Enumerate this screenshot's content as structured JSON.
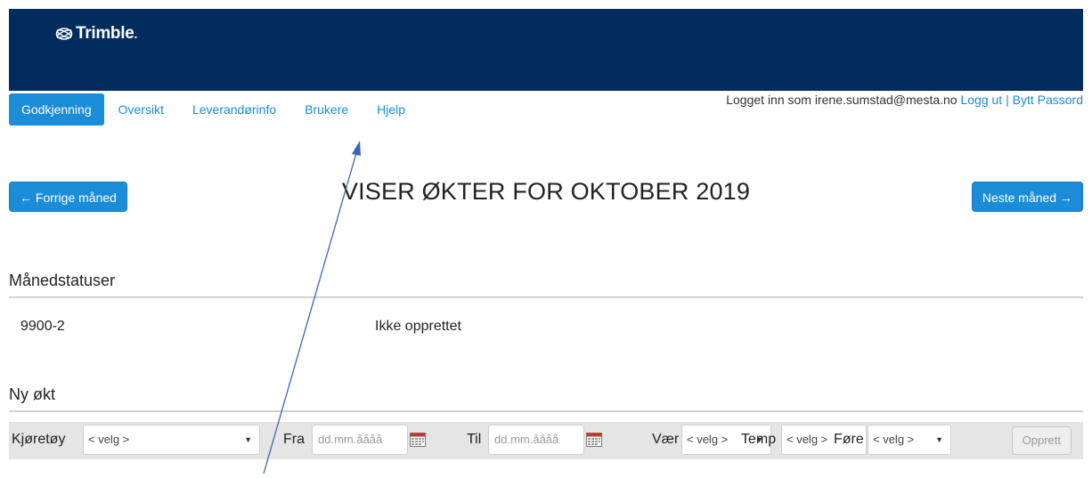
{
  "header": {
    "logo_text": "Trimble",
    "logo_dot": ".",
    "bg_color": "#012c5b"
  },
  "nav": {
    "items": [
      {
        "label": "Godkjenning",
        "active": true
      },
      {
        "label": "Oversikt"
      },
      {
        "label": "Leverandørinfo"
      },
      {
        "label": "Brukere"
      },
      {
        "label": "Hjelp"
      }
    ]
  },
  "userbar": {
    "logged_in_text": "Logget inn som irene.sumstad@mesta.no",
    "logout_label": "Logg ut",
    "separator": "|",
    "change_password_label": "Bytt Passord"
  },
  "month_nav": {
    "prev_label": "← Forrige måned",
    "next_label": "Neste måned →",
    "title": "VISER ØKTER FOR OKTOBER 2019"
  },
  "month_status": {
    "title": "Månedstatuser",
    "rows": [
      {
        "code": "9900-2",
        "status": "Ikke opprettet"
      }
    ]
  },
  "new_session": {
    "title": "Ny økt",
    "vehicle_label": "Kjøretøy",
    "vehicle_value": "< velg >",
    "from_label": "Fra",
    "from_placeholder": "dd.mm.åååå",
    "to_label": "Til",
    "to_placeholder": "dd.mm.åååå",
    "weather_label": "Vær",
    "weather_value": "< velg >",
    "temp_label": "Temp",
    "temp_value": "< velg >",
    "surface_label": "Føre",
    "surface_value": "< velg >",
    "create_label": "Opprett"
  },
  "colors": {
    "accent": "#1a8cd8",
    "header": "#012c5b",
    "annotation_arrow": "#3a66b5"
  },
  "icons": {
    "logo": "trimble-globe-icon",
    "calendar": "calendar-icon",
    "dropdown": "chevron-down-icon"
  }
}
